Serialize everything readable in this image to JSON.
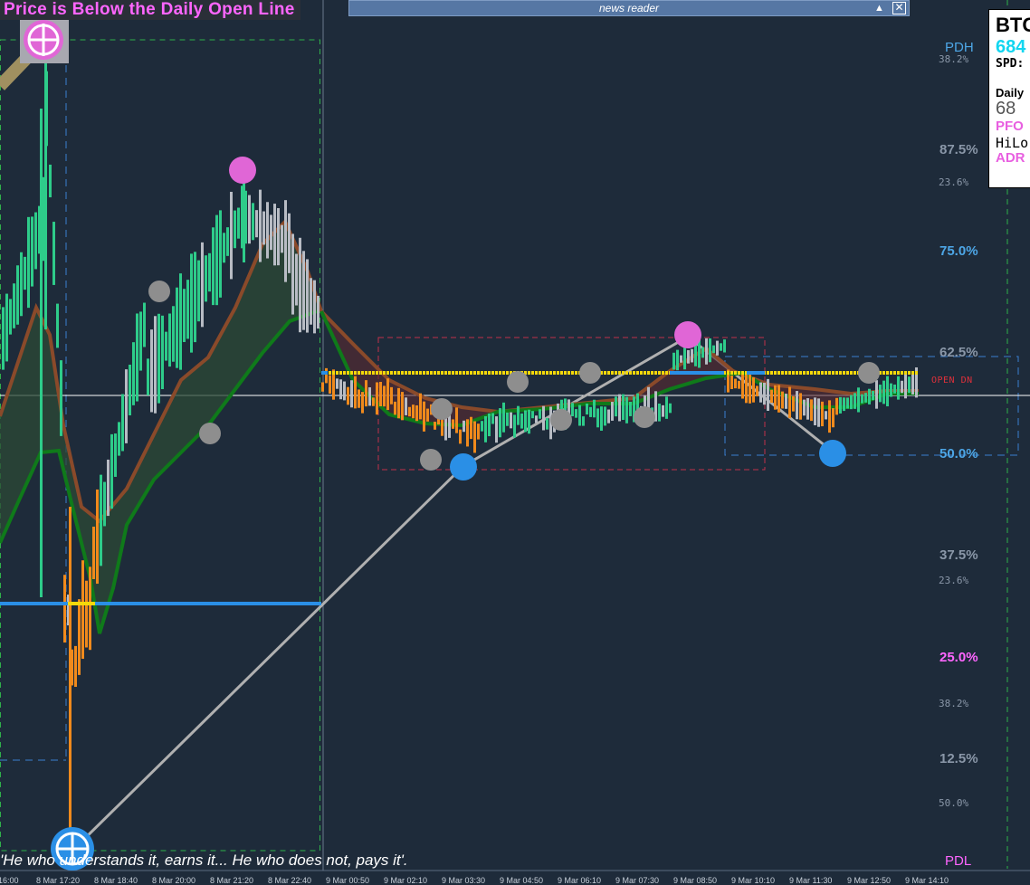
{
  "status_title": "Price is Below the Daily Open Line",
  "news": {
    "title": "news reader",
    "minimize_glyph": "▲",
    "close_glyph": "✕"
  },
  "info_panel": {
    "symbol": "BTC",
    "price": "684",
    "spread": "SPD:",
    "daily_label": "Daily",
    "daily_value": "68",
    "pfo": "PFO",
    "hilo": "HiLo",
    "adr": "ADR"
  },
  "quote": "'He who understands it, earns it... He who does not, pays it'.",
  "levels": {
    "pdh": "PDH",
    "pdl": "PDL",
    "open_label": "OPEN DN",
    "fib_pct": [
      "87.5%",
      "75.0%",
      "62.5%",
      "50.0%",
      "37.5%",
      "25.0%",
      "12.5%"
    ],
    "fib_small": [
      "38.2%",
      "23.6%",
      "23.6%",
      "38.2%",
      "50.0%"
    ]
  },
  "x_ticks": [
    "16:00",
    "8 Mar 17:20",
    "8 Mar 18:40",
    "8 Mar 20:00",
    "8 Mar 21:20",
    "8 Mar 22:40",
    "9 Mar 00:50",
    "9 Mar 02:10",
    "9 Mar 03:30",
    "9 Mar 04:50",
    "9 Mar 06:10",
    "9 Mar 07:30",
    "9 Mar 08:50",
    "9 Mar 10:10",
    "9 Mar 11:30",
    "9 Mar 12:50",
    "9 Mar 14:10"
  ],
  "colors": {
    "background": "#1e2b3a",
    "bull": "#2ecc8a",
    "bear": "#f08a1c",
    "neutral": "#b8bcc4",
    "open_line": "#f5d90a",
    "fast_ma": "#0f7a1a",
    "slow_ma": "#8a4a2a",
    "magenta": "#e066d6",
    "blue": "#2a8fe6",
    "fib_blue": "#4da6e6",
    "fib_pink": "#ff66ff"
  }
}
